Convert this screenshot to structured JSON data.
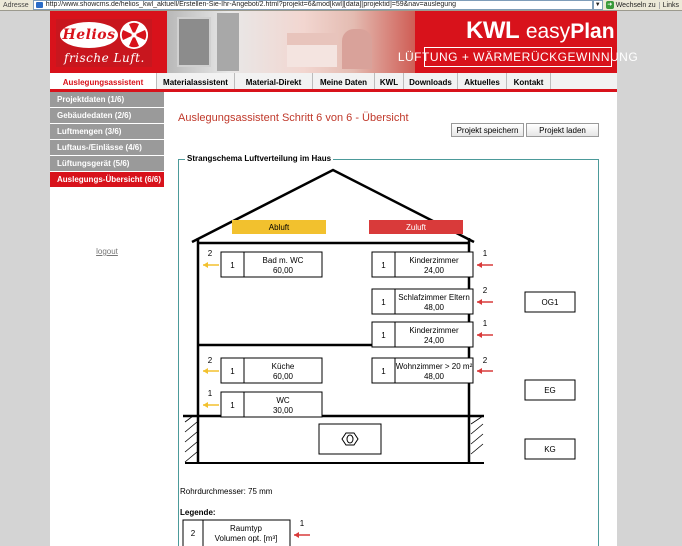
{
  "browser": {
    "address_label": "Adresse",
    "url": "http://www.showcms.de/helios_kwl_aktuell/Erstellen-Sie-Ihr-Angebot/2.html?projekt=6&mod[kwl][data][projektid]=59&nav=auslegung",
    "go_label": "Wechseln zu",
    "links_label": "Links"
  },
  "header": {
    "logo": "Helios",
    "slogan": "frische Luft.",
    "brand_kwl": "KWL",
    "brand_easy": "easy",
    "brand_plan": "Plan",
    "brand_tagline": "LÜFTUNG + WÄRMERÜCKGEWINNUNG"
  },
  "nav": {
    "items": [
      {
        "label": "Auslegungsassistent",
        "active": true
      },
      {
        "label": "Materialassistent",
        "active": false
      },
      {
        "label": "Material-Direkt",
        "active": false
      },
      {
        "label": "Meine Daten",
        "active": false
      },
      {
        "label": "KWL",
        "active": false
      },
      {
        "label": "Downloads",
        "active": false
      },
      {
        "label": "Aktuelles",
        "active": false
      },
      {
        "label": "Kontakt",
        "active": false
      }
    ]
  },
  "sidebar": {
    "items": [
      {
        "label": "Projektdaten (1/6)",
        "active": false
      },
      {
        "label": "Gebäudedaten (2/6)",
        "active": false
      },
      {
        "label": "Luftmengen (3/6)",
        "active": false
      },
      {
        "label": "Luftaus-/Einlässe (4/6)",
        "active": false
      },
      {
        "label": "Lüftungsgerät (5/6)",
        "active": false
      },
      {
        "label": "Auslegungs-Übersicht (6/6)",
        "active": true
      }
    ],
    "logout": "logout"
  },
  "main": {
    "title": "Auslegungsassistent Schritt 6 von 6 - Übersicht",
    "save_button": "Projekt speichern",
    "load_button": "Projekt laden",
    "schema_title": "Strangschema Luftverteilung im Haus"
  },
  "schema": {
    "abluft_label": "Abluft",
    "zuluft_label": "Zuluft",
    "colors": {
      "abluft": "#f2c12e",
      "zuluft": "#d93a3a",
      "arrow_abluft": "#f2c12e",
      "arrow_zuluft": "#d93a3a"
    },
    "abluft_rooms": [
      {
        "count": "2",
        "qty": "1",
        "name": "Bad m. WC",
        "volume": "60,00"
      },
      {
        "count": "2",
        "qty": "1",
        "name": "Küche",
        "volume": "60,00"
      },
      {
        "count": "1",
        "qty": "1",
        "name": "WC",
        "volume": "30,00"
      }
    ],
    "zuluft_rooms": [
      {
        "count": "1",
        "qty": "1",
        "name": "Kinderzimmer",
        "volume": "24,00"
      },
      {
        "count": "2",
        "qty": "1",
        "name": "Schlafzimmer Eltern",
        "volume": "48,00"
      },
      {
        "count": "1",
        "qty": "1",
        "name": "Kinderzimmer",
        "volume": "24,00"
      },
      {
        "count": "2",
        "qty": "1",
        "name": "Wohnzimmer > 20 m²",
        "volume": "48,00"
      }
    ],
    "floors": [
      "OG1",
      "EG",
      "KG"
    ]
  },
  "footer": {
    "diameter": "Rohrdurchmesser:   75 mm",
    "legend_title": "Legende:",
    "legend_count": "1",
    "legend_qty": "2",
    "legend_line1": "Raumtyp",
    "legend_line2": "Volumen opt. [m³]"
  }
}
